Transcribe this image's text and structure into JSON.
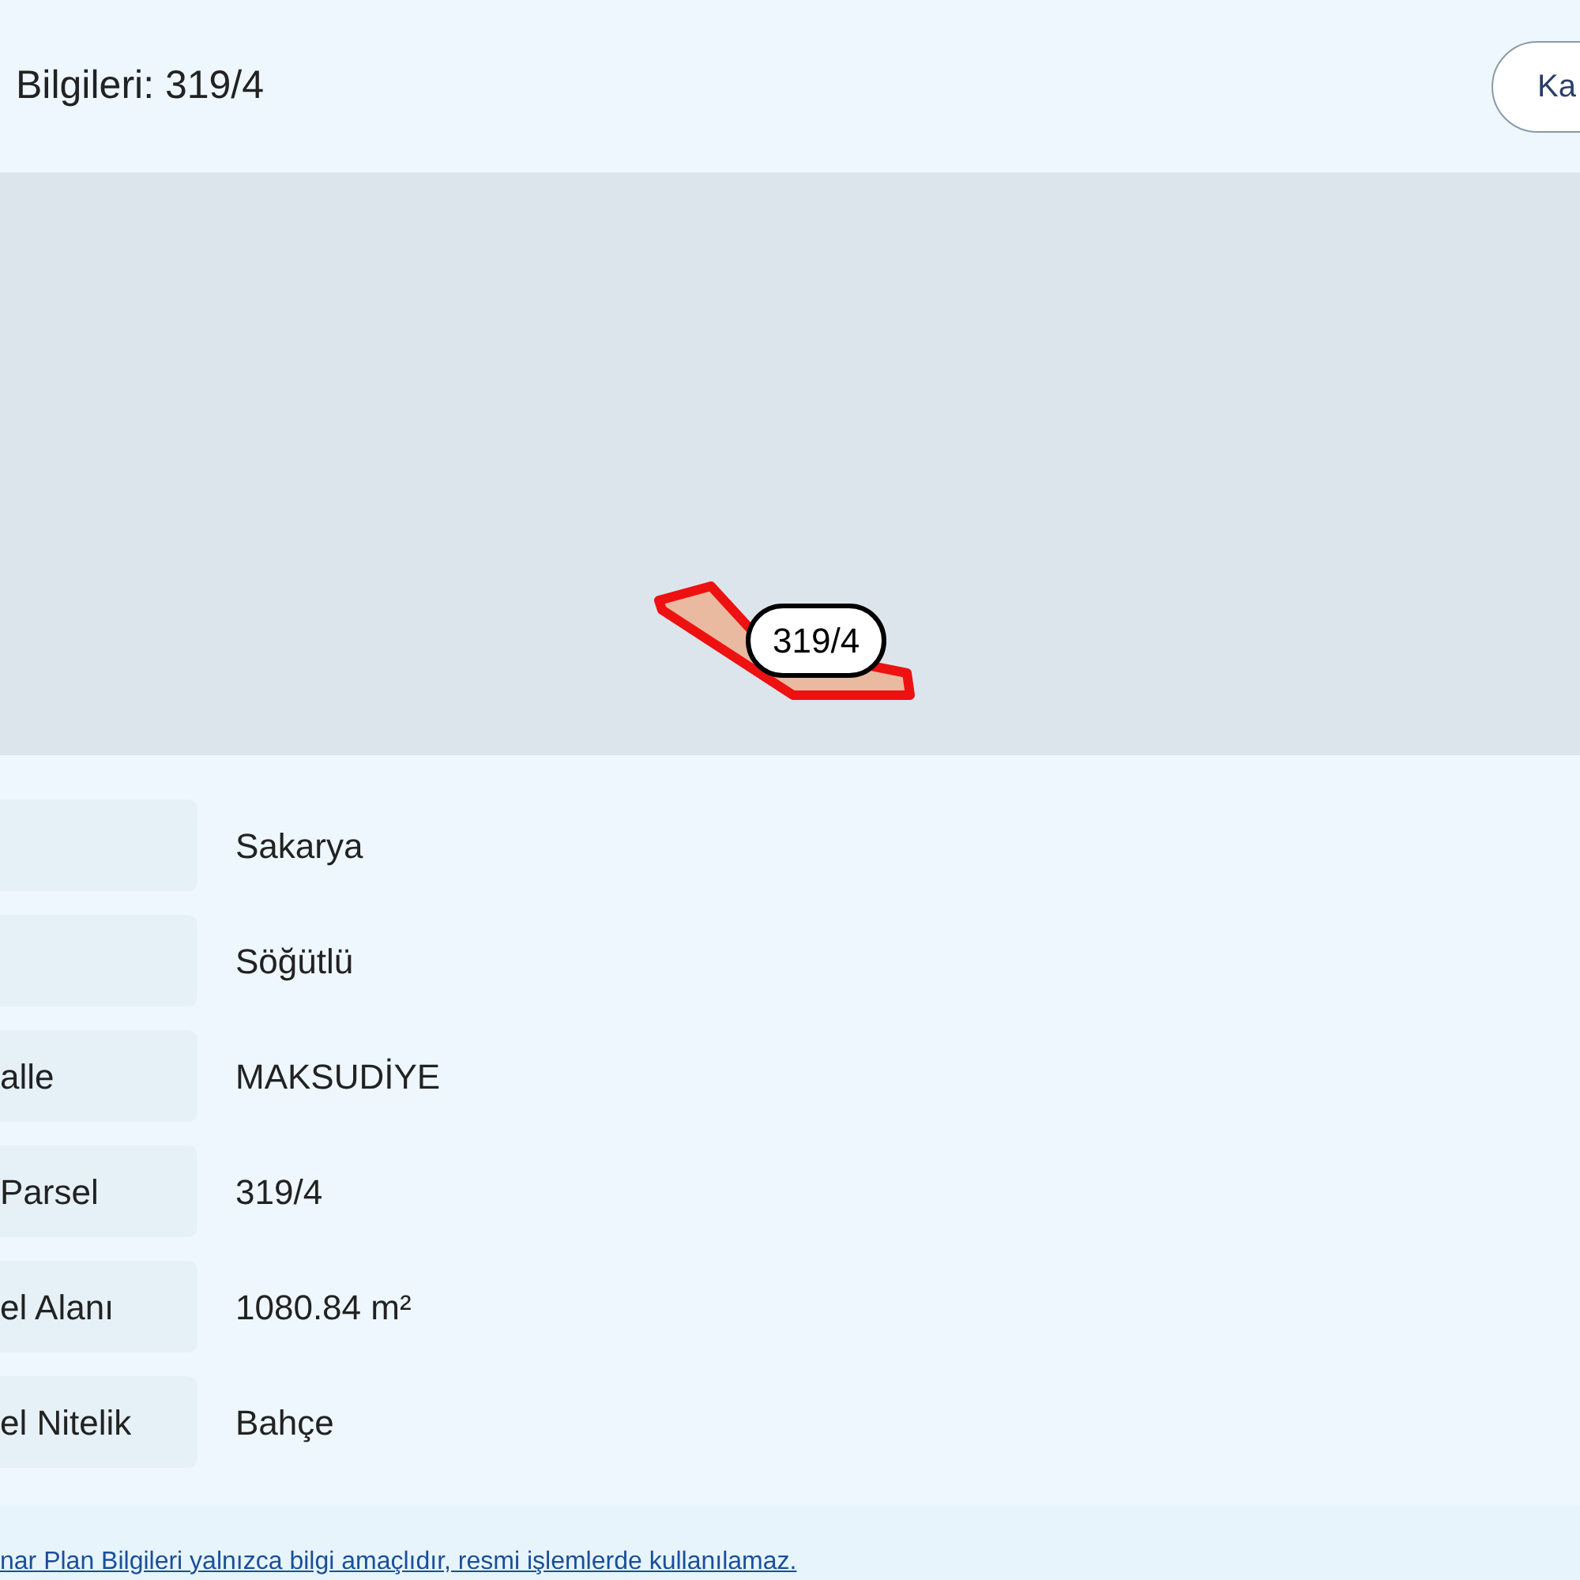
{
  "header": {
    "title": "Bilgileri: 319/4",
    "button": "Ka"
  },
  "map": {
    "parcel_label": "319/4"
  },
  "rows": [
    {
      "value": "Sakarya"
    },
    {
      "value": "Söğütlü"
    },
    {
      "label": "alle",
      "value": "MAKSUDİYE"
    },
    {
      "label": "Parsel",
      "value": "319/4"
    },
    {
      "label": "el Alanı",
      "value": "1080.84 m²"
    },
    {
      "label": "el Nitelik",
      "value": "Bahçe"
    }
  ],
  "footer_note": "nar Plan Bilgileri yalnızca bilgi amaçlıdır, resmi işlemlerde kullanılamaz."
}
